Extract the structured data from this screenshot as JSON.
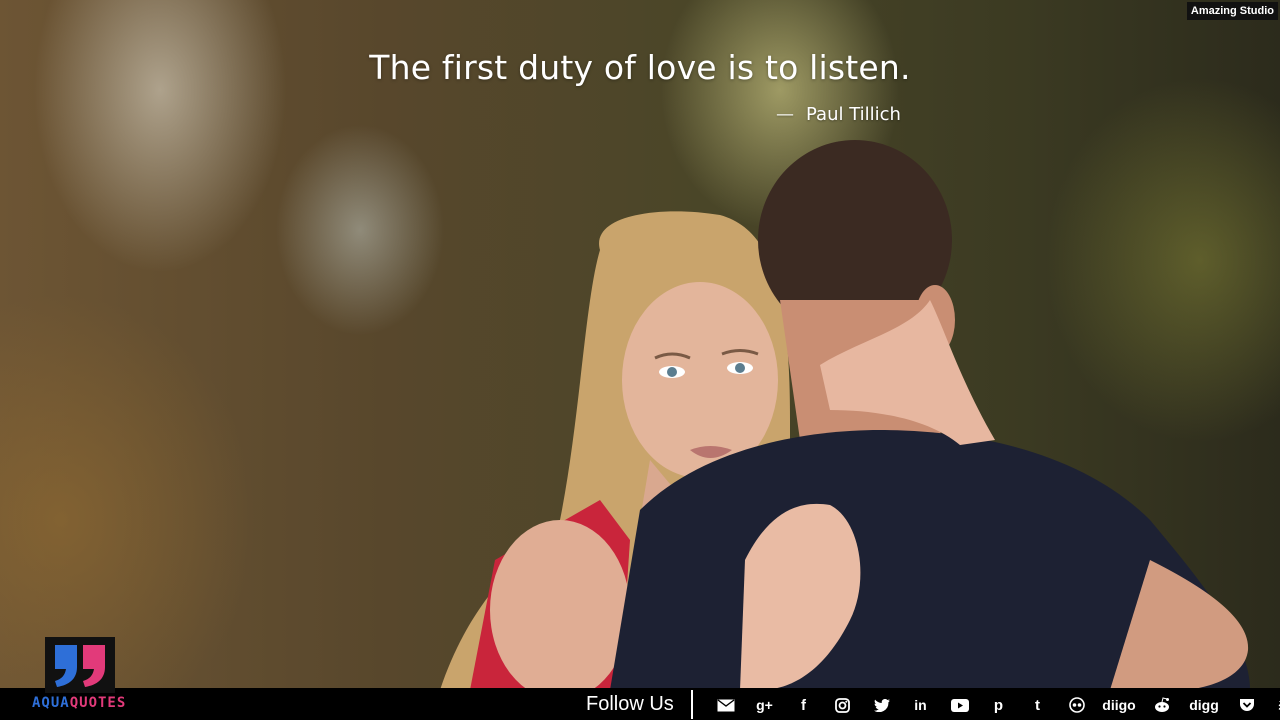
{
  "quote": {
    "text": "The first duty of love is to listen.",
    "author": "Paul Tillich",
    "dash": "—"
  },
  "watermark": {
    "label": "Amazing Studio"
  },
  "brand": {
    "name_part1": "AQUA",
    "name_part2": "QUOTES",
    "colors": {
      "blue": "#2e6fd8",
      "pink": "#e23a7a"
    }
  },
  "footer": {
    "follow_label": "Follow Us",
    "social": [
      {
        "name": "email-icon",
        "text": ""
      },
      {
        "name": "google-plus-icon",
        "text": "g+"
      },
      {
        "name": "facebook-icon",
        "text": "f"
      },
      {
        "name": "instagram-icon",
        "text": ""
      },
      {
        "name": "twitter-icon",
        "text": ""
      },
      {
        "name": "linkedin-icon",
        "text": "in"
      },
      {
        "name": "youtube-icon",
        "text": ""
      },
      {
        "name": "pinterest-icon",
        "text": "p"
      },
      {
        "name": "tumblr-icon",
        "text": "t"
      },
      {
        "name": "flickr-icon",
        "text": ""
      },
      {
        "name": "diigo-icon",
        "text": "diigo"
      },
      {
        "name": "reddit-icon",
        "text": ""
      },
      {
        "name": "digg-icon",
        "text": "digg"
      },
      {
        "name": "pocket-icon",
        "text": ""
      },
      {
        "name": "buffer-icon",
        "text": ""
      }
    ]
  }
}
